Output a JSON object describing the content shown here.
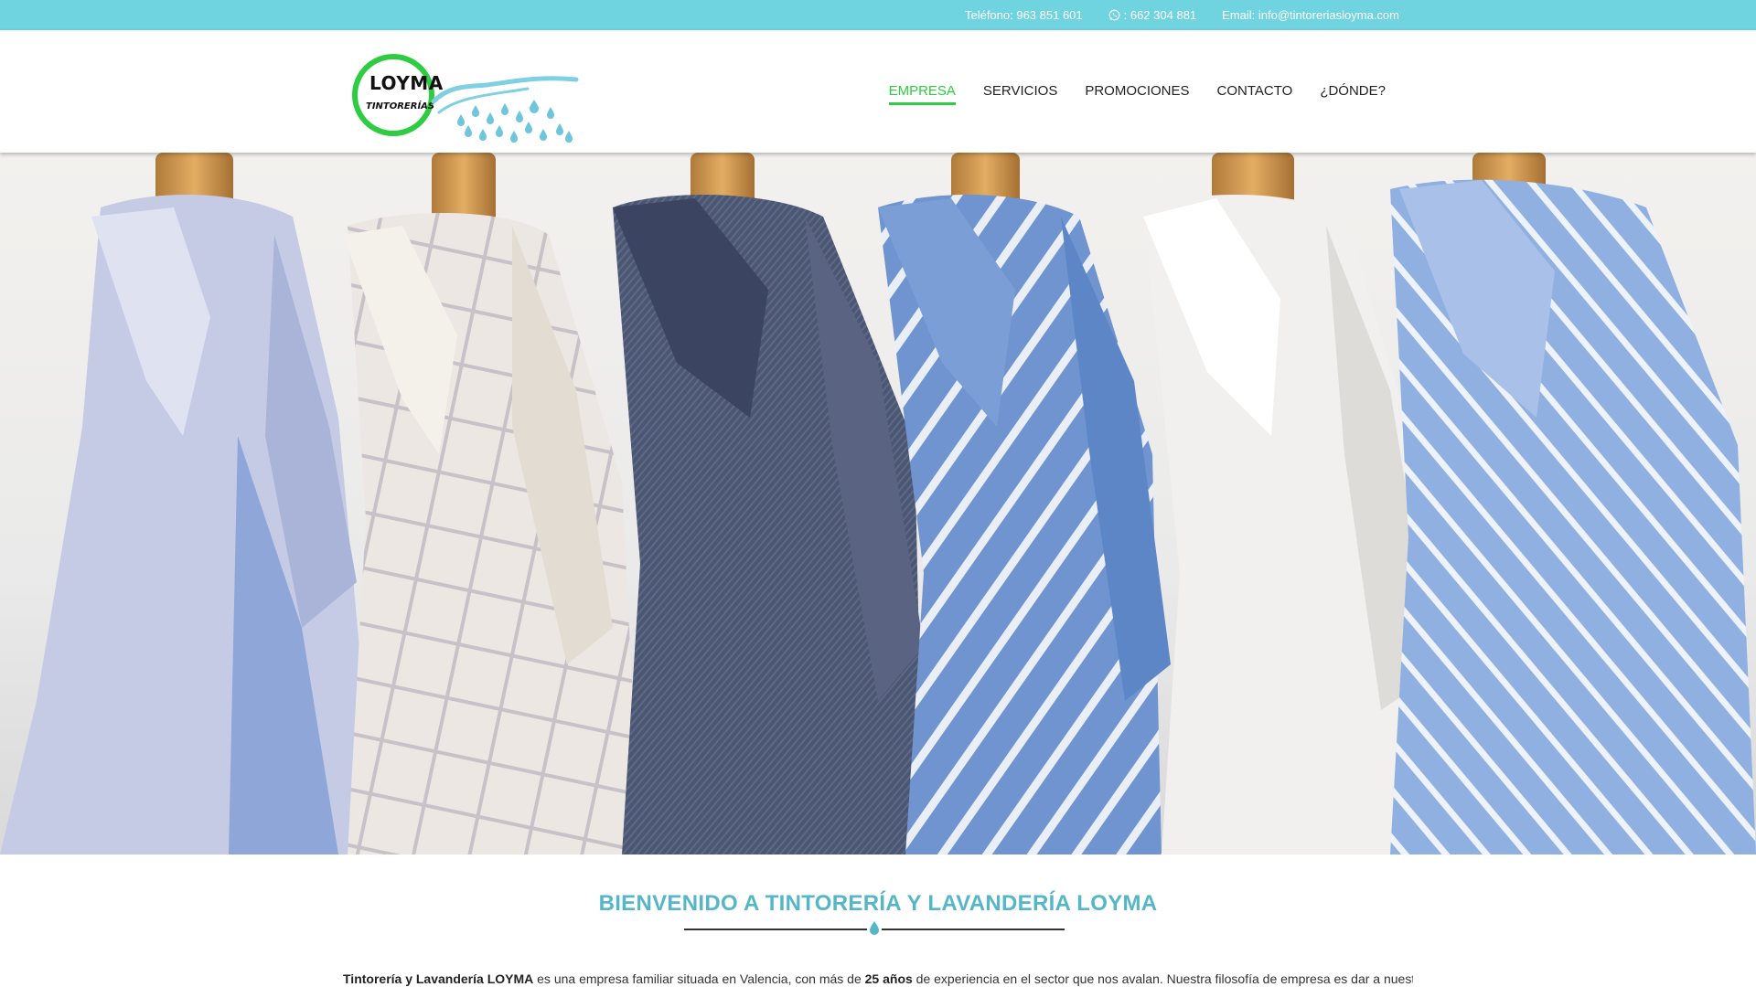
{
  "topbar": {
    "phone_label": "Teléfono: 963 851 601",
    "whatsapp_label": ": 662 304 881",
    "email_label": "Email: info@tintoreriasloyma.com"
  },
  "logo": {
    "name": "LOYMA",
    "subtitle": "TINTORERÍAS"
  },
  "nav": {
    "items": [
      {
        "label": "EMPRESA",
        "active": true
      },
      {
        "label": "SERVICIOS",
        "active": false
      },
      {
        "label": "PROMOCIONES",
        "active": false
      },
      {
        "label": "CONTACTO",
        "active": false
      },
      {
        "label": "¿DÓNDE?",
        "active": false
      }
    ]
  },
  "welcome": {
    "title": "BIENVENIDO A TINTORERÍA Y LAVANDERÍA LOYMA",
    "intro_bold_1": "Tintorería y Lavandería LOYMA",
    "intro_text_1": " es una empresa familiar situada en Valencia, con más de ",
    "intro_bold_2": "25 años",
    "intro_text_2": " de experiencia en el sector que nos avalan. Nuestra filosofía de empresa es dar a nuestros"
  },
  "colors": {
    "topbar": "#6fd3e0",
    "accent_green": "#2ecc40",
    "title_blue": "#55b6c8"
  }
}
